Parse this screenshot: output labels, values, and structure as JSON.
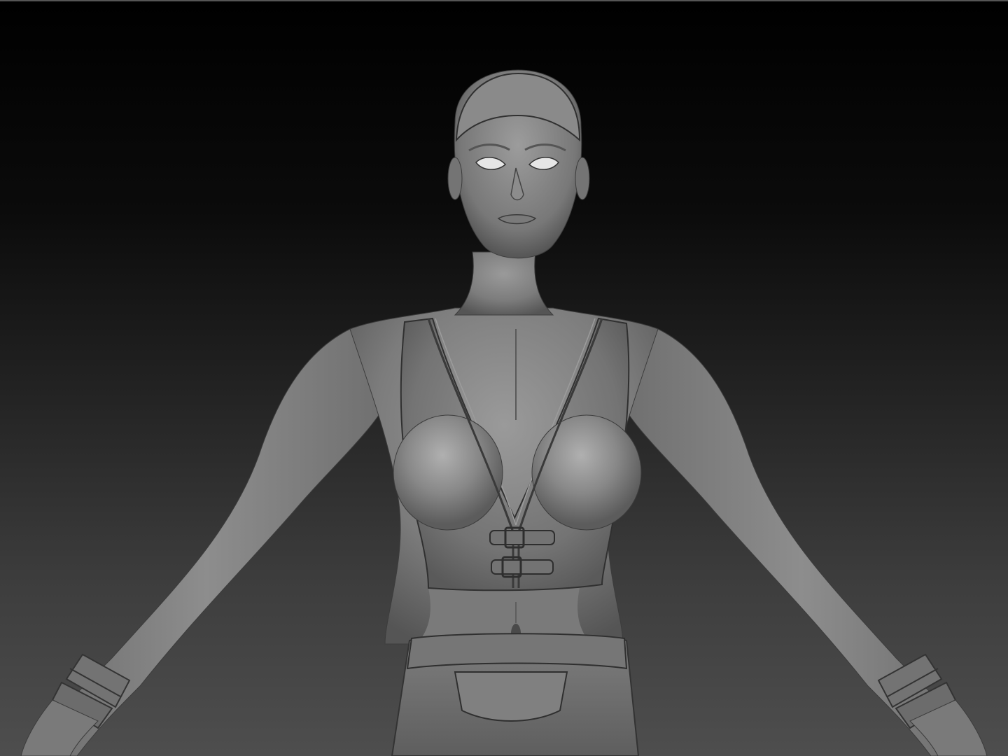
{
  "viewport": {
    "background_top": "#000000",
    "background_bottom": "#4e4e4e",
    "material_color": "#8a8a8a"
  },
  "model": {
    "subject": "sculpted-female-figure"
  }
}
